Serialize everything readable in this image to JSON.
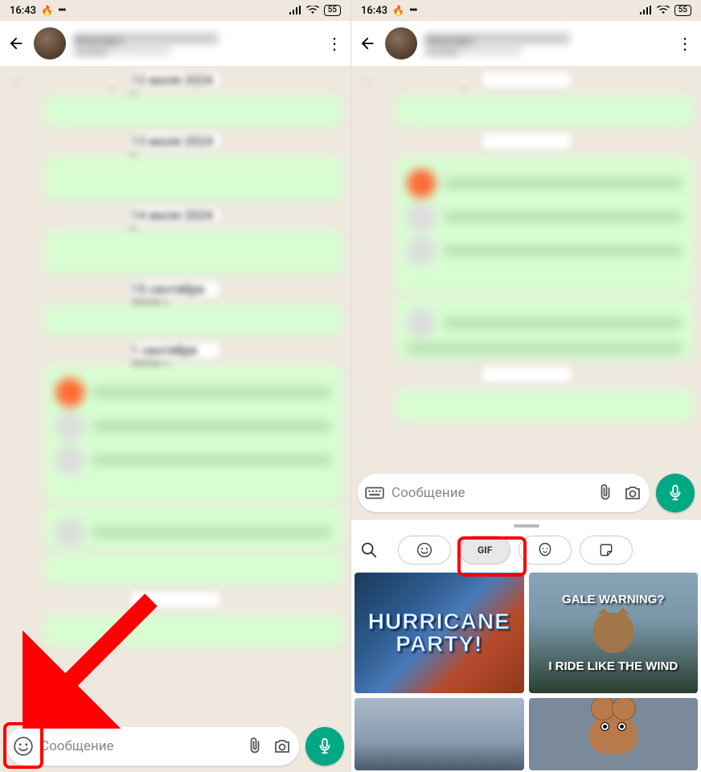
{
  "status": {
    "time": "16:43",
    "battery": "55"
  },
  "header": {
    "contact_name": "Контакт",
    "contact_sub": "онлайн"
  },
  "chat": {
    "date1": "12 июля 2024 г.",
    "date2": "13 июля 2024 г.",
    "date3": "14 июля 2024 г.",
    "date4": "15 сентября 2024 г.",
    "date5": "1 сентября 2024 г."
  },
  "input": {
    "placeholder": "Сообщение"
  },
  "panel": {
    "gif_label": "GIF",
    "gif1_line1": "HURRICANE",
    "gif1_line2": "PARTY!",
    "gif2_top": "GALE WARNING?",
    "gif2_bottom": "I RIDE LIKE THE WIND"
  },
  "icons": {
    "search": "search",
    "emoji": "emoji",
    "avatar": "avatar-face",
    "sticker": "sticker",
    "attach": "attach",
    "camera": "camera",
    "mic": "mic",
    "keyboard": "keyboard"
  }
}
